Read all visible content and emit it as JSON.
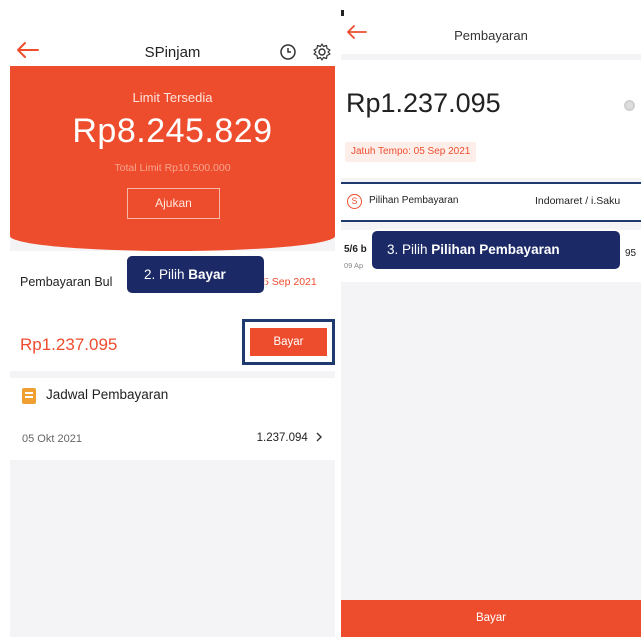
{
  "left": {
    "header": {
      "title": "SPinjam"
    },
    "banner": {
      "limit_label": "Limit Tersedia",
      "limit_value": "Rp8.245.829",
      "total_limit": "Total Limit Rp10.500.000",
      "ajukan_label": "Ajukan"
    },
    "payment": {
      "title": "Pembayaran Bul",
      "due_date": "5 Sep 2021",
      "amount": "Rp1.237.095",
      "bayar_label": "Bayar"
    },
    "schedule": {
      "title": "Jadwal Pembayaran",
      "date": "05 Okt 2021",
      "amount": "1.237.094"
    }
  },
  "right": {
    "header": {
      "title": "Pembayaran"
    },
    "amount": "Rp1.237.095",
    "due_pill": "Jatuh Tempo: 05 Sep 2021",
    "method": {
      "icon_glyph": "S",
      "label": "Pilihan Pembayaran",
      "value": "Indomaret / i.Saku"
    },
    "item": {
      "main": "5/6 b",
      "sub": "09 Ap",
      "amount": "95"
    },
    "bayar_label": "Bayar"
  },
  "callouts": {
    "step2": {
      "prefix": "2. Pilih ",
      "bold": "Bayar"
    },
    "step3": {
      "prefix": "3. Pilih ",
      "bold": "Pilihan Pembayaran"
    }
  },
  "colors": {
    "accent": "#ee4d2d",
    "callout": "#1b2a66",
    "highlight": "#1e3a6e"
  },
  "icons": {
    "back": "arrow-left-icon",
    "history": "clock-icon",
    "settings": "gear-icon",
    "schedule": "document-icon",
    "chevron": "chevron-right-icon",
    "payment_method": "currency-circle-icon",
    "status": "dot-icon"
  }
}
